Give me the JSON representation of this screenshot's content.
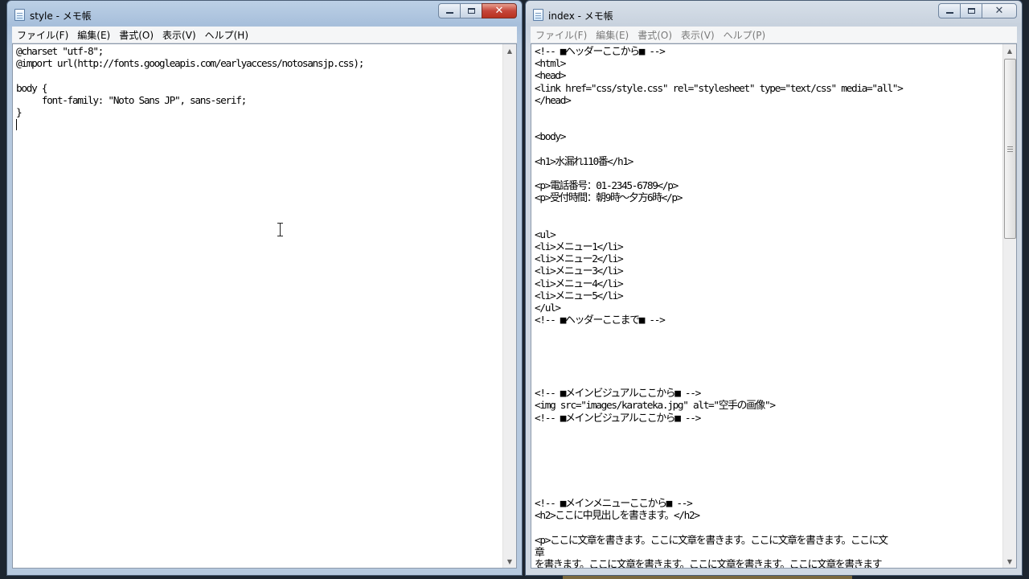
{
  "left_window": {
    "title": "style - メモ帳",
    "menu": [
      "ファイル(F)",
      "編集(E)",
      "書式(O)",
      "表示(V)",
      "ヘルプ(H)"
    ],
    "lines": [
      "@charset \"utf-8\";",
      "@import url(http://fonts.googleapis.com/earlyaccess/notosansjp.css);",
      "",
      "body {",
      "     font-family: \"Noto Sans JP\", sans-serif;",
      "}",
      ""
    ]
  },
  "right_window": {
    "title": "index - メモ帳",
    "menu": [
      "ファイル(F)",
      "編集(E)",
      "書式(O)",
      "表示(V)",
      "ヘルプ(P)"
    ],
    "lines": [
      "<!-- ■ヘッダーここから■ -->",
      "<html>",
      "<head>",
      "<link href=\"css/style.css\" rel=\"stylesheet\" type=\"text/css\" media=\"all\">",
      "</head>",
      "",
      "",
      "<body>",
      "",
      "<h1>水漏れ110番</h1>",
      "",
      "<p>電話番号：01-2345-6789</p>",
      "<p>受付時間：朝9時～夕方6時</p>",
      "",
      "",
      "<ul>",
      "<li>メニュー1</li>",
      "<li>メニュー2</li>",
      "<li>メニュー3</li>",
      "<li>メニュー4</li>",
      "<li>メニュー5</li>",
      "</ul>",
      "<!-- ■ヘッダーここまで■ -->",
      "",
      "",
      "",
      "",
      "",
      "<!-- ■メインビジュアルここから■ -->",
      "<img src=\"images/karateka.jpg\" alt=\"空手の画像\">",
      "<!-- ■メインビジュアルここから■ -->",
      "",
      "",
      "",
      "",
      "",
      "",
      "<!-- ■メインメニューここから■ -->",
      "<h2>ここに中見出しを書きます。</h2>",
      "",
      "<p>ここに文章を書きます。ここに文章を書きます。ここに文章を書きます。ここに文",
      "章",
      "を書きます。ここに文章を書きます。ここに文章を書きます。ここに文章を書きます",
      "。"
    ]
  },
  "icons": {
    "app": "notepad-icon",
    "minimize": "minimize-icon",
    "maximize": "maximize-icon",
    "close": "close-icon",
    "cursor": "text-cursor-icon"
  },
  "colors": {
    "close_button_active": "#c5463a",
    "editor_background": "#ffffff"
  }
}
